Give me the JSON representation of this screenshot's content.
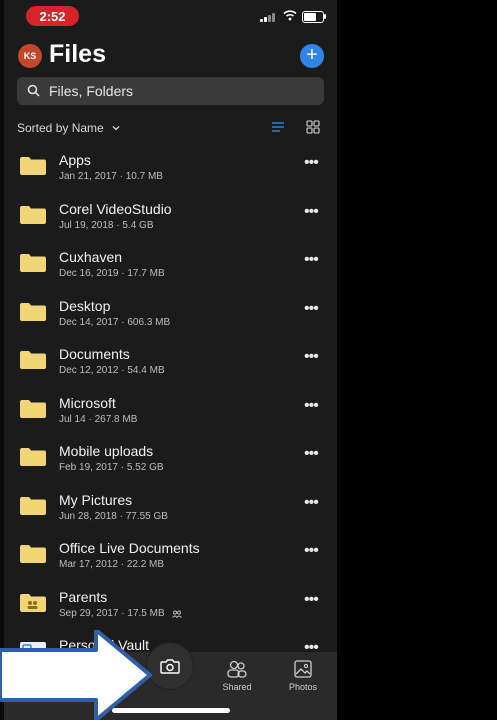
{
  "status_bar": {
    "time": "2:52"
  },
  "header": {
    "avatar_initials": "KS",
    "title": "Files",
    "add_label": "+"
  },
  "search": {
    "placeholder": "Files, Folders"
  },
  "sort": {
    "label": "Sorted by Name"
  },
  "files": [
    {
      "name": "Apps",
      "meta": "Jan 21, 2017 · 10.7 MB"
    },
    {
      "name": "Corel VideoStudio",
      "meta": "Jul 19, 2018 · 5.4 GB"
    },
    {
      "name": "Cuxhaven",
      "meta": "Dec 16, 2019 · 17.7 MB"
    },
    {
      "name": "Desktop",
      "meta": "Dec 14, 2017 · 606.3 MB"
    },
    {
      "name": "Documents",
      "meta": "Dec 12, 2012 · 54.4 MB"
    },
    {
      "name": "Microsoft",
      "meta": "Jul 14 · 267.8 MB"
    },
    {
      "name": "Mobile uploads",
      "meta": "Feb 19, 2017 · 5.52 GB"
    },
    {
      "name": "My Pictures",
      "meta": "Jun 28, 2018 · 77.55 GB"
    },
    {
      "name": "Office Live Documents",
      "meta": "Mar 17, 2012 · 22.2 MB"
    },
    {
      "name": "Parents",
      "meta": "Sep 29, 2017 · 17.5 MB"
    },
    {
      "name": "Personal Vault",
      "meta": ""
    }
  ],
  "more_label": "•••",
  "tabs": {
    "shared": "Shared",
    "photos": "Photos"
  },
  "colors": {
    "accent": "#2f86e8",
    "folder": "#f2d675",
    "avatar": "#c4472c",
    "time_pill": "#d7242a"
  }
}
